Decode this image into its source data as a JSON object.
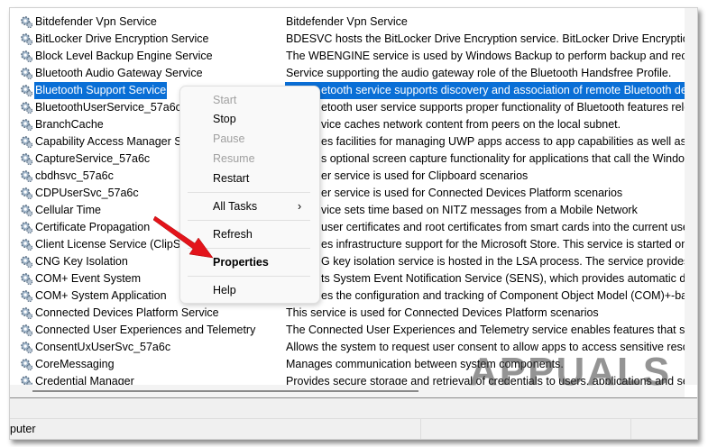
{
  "services": [
    {
      "name": "Bitdefender Vpn Service",
      "description": "Bitdefender Vpn Service"
    },
    {
      "name": "BitLocker Drive Encryption Service",
      "description": "BDESVC hosts the BitLocker Drive Encryption service. BitLocker Drive Encryption pro"
    },
    {
      "name": "Block Level Backup Engine Service",
      "description": "The WBENGINE service is used by Windows Backup to perform backup and recovery"
    },
    {
      "name": "Bluetooth Audio Gateway Service",
      "description": "Service supporting the audio gateway role of the Bluetooth Handsfree Profile."
    },
    {
      "name": "Bluetooth Support Service",
      "description": "etooth service supports discovery and association of remote Bluetooth devic",
      "selected": true
    },
    {
      "name": "BluetoothUserService_57a6c",
      "description": "etooth user service supports proper functionality of Bluetooth features releva"
    },
    {
      "name": "BranchCache",
      "description": "vice caches network content from peers on the local subnet."
    },
    {
      "name": "Capability Access Manager Ser",
      "description": "es facilities for managing UWP apps access to app capabilities as well as check"
    },
    {
      "name": "CaptureService_57a6c",
      "description": "s optional screen capture functionality for applications that call the Windows."
    },
    {
      "name": "cbdhsvc_57a6c",
      "description": "er service is used for Clipboard scenarios"
    },
    {
      "name": "CDPUserSvc_57a6c",
      "description": "er service is used for Connected Devices Platform scenarios"
    },
    {
      "name": "Cellular Time",
      "description": "vice sets time based on NITZ messages from a Mobile Network"
    },
    {
      "name": "Certificate Propagation",
      "description": "user certificates and root certificates from smart cards into the current user's"
    },
    {
      "name": "Client License Service (ClipSVC",
      "description": "es infrastructure support for the Microsoft Store. This service is started on dem"
    },
    {
      "name": "CNG Key Isolation",
      "description": "G key isolation service is hosted in the LSA process. The service provides key"
    },
    {
      "name": "COM+ Event System",
      "description": "ts System Event Notification Service (SENS), which provides automatic distrib"
    },
    {
      "name": "COM+ System Application",
      "description": "es the configuration and tracking of Component Object Model (COM)+-base"
    },
    {
      "name": "Connected Devices Platform Service",
      "description": "This service is used for Connected Devices Platform scenarios"
    },
    {
      "name": "Connected User Experiences and Telemetry",
      "description": "The Connected User Experiences and Telemetry service enables features that support"
    },
    {
      "name": "ConsentUxUserSvc_57a6c",
      "description": "Allows the system to request user consent to allow apps to access sensitive resource"
    },
    {
      "name": "CoreMessaging",
      "description": "Manages communication between system components."
    },
    {
      "name": "Credential Manager",
      "description": "Provides secure storage and retrieval of credentials to users, applications and securit"
    }
  ],
  "context_menu": {
    "items": [
      {
        "label": "Start",
        "disabled": true
      },
      {
        "label": "Stop"
      },
      {
        "label": "Pause",
        "disabled": true
      },
      {
        "label": "Resume",
        "disabled": true
      },
      {
        "label": "Restart"
      },
      {
        "label": "All Tasks",
        "submenu": true
      },
      {
        "label": "Refresh"
      },
      {
        "label": "Properties",
        "bold": true
      },
      {
        "label": "Help"
      }
    ],
    "submenu_chevron": "›"
  },
  "status_bar": {
    "text": "puter"
  },
  "watermark": "APPUALS",
  "colors": {
    "selection": "#0a6fd6",
    "arrow": "#e3141b"
  }
}
